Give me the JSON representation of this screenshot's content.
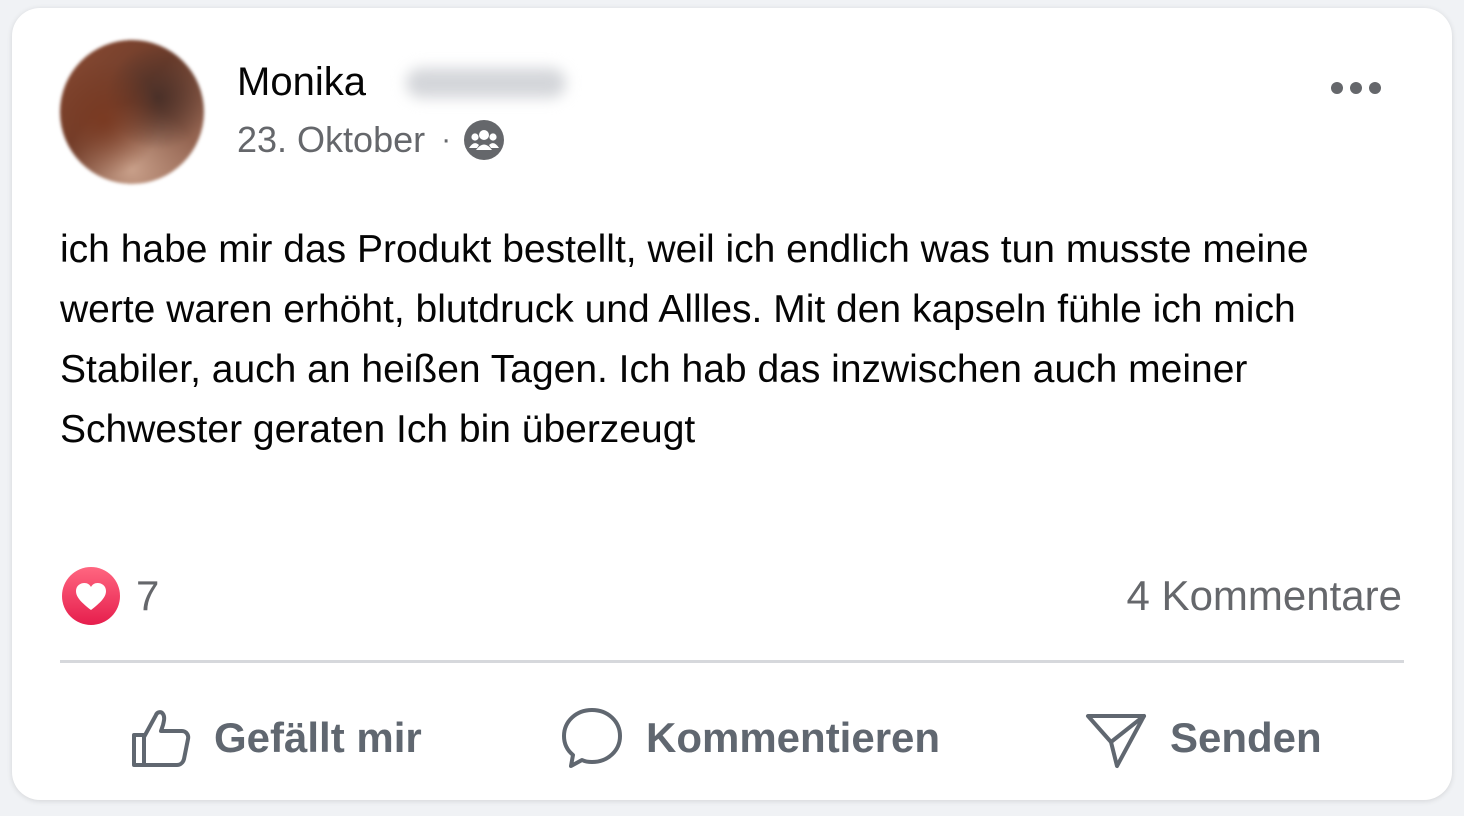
{
  "post": {
    "author_first_name": "Monika",
    "date": "23. Oktober",
    "separator": "·",
    "audience_icon": "group-icon",
    "text": "ich habe mir das Produkt bestellt, weil ich endlich was tun musste meine werte waren erhöht, blutdruck und Allles. Mit den kapseln fühle ich mich Stabiler, auch an heißen Tagen. Ich hab das inzwischen auch meiner Schwester geraten Ich bin überzeugt",
    "reaction_icon": "heart-icon",
    "reaction_count": "7",
    "comment_count": "4 Kommentare"
  },
  "actions": {
    "like_label": "Gefällt mir",
    "comment_label": "Kommentieren",
    "send_label": "Senden"
  },
  "colors": {
    "text_primary": "#050505",
    "text_secondary": "#65676b",
    "action_text": "#606770",
    "heart": "#f0284a",
    "divider": "#d6d8dc"
  }
}
